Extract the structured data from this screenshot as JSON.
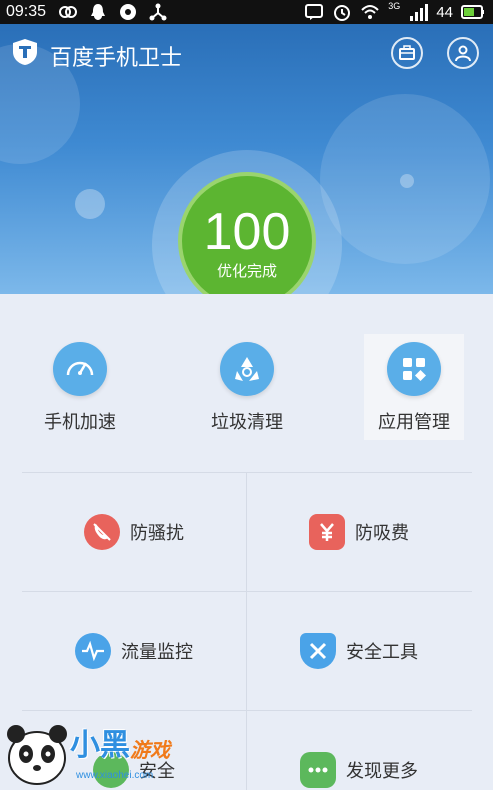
{
  "status_bar": {
    "time": "09:35",
    "network": "3G",
    "battery": "44"
  },
  "header": {
    "title": "百度手机卫士"
  },
  "score": {
    "value": "100",
    "label": "优化完成"
  },
  "quick_actions": [
    {
      "label": "手机加速",
      "icon": "speedometer-icon"
    },
    {
      "label": "垃圾清理",
      "icon": "recycle-icon"
    },
    {
      "label": "应用管理",
      "icon": "apps-grid-icon"
    }
  ],
  "features": [
    {
      "label": "防骚扰",
      "icon": "phone-block-icon",
      "color": "#e8635c"
    },
    {
      "label": "防吸费",
      "icon": "yuan-shield-icon",
      "color": "#e8635c"
    },
    {
      "label": "流量监控",
      "icon": "traffic-wave-icon",
      "color": "#4aa3e8"
    },
    {
      "label": "安全工具",
      "icon": "tools-shield-icon",
      "color": "#4aa3e8"
    },
    {
      "label": "安全",
      "icon": "hidden-icon",
      "color": "#5cb85c"
    },
    {
      "label": "发现更多",
      "icon": "more-dots-icon",
      "color": "#5cb85c"
    }
  ],
  "watermark": {
    "brand": "小黑",
    "brand2": "游戏",
    "url": "www.xiaohei.com"
  },
  "colors": {
    "header_top": "#2a6fb8",
    "score_green": "#5cb531",
    "quick_blue": "#5aaee8"
  }
}
